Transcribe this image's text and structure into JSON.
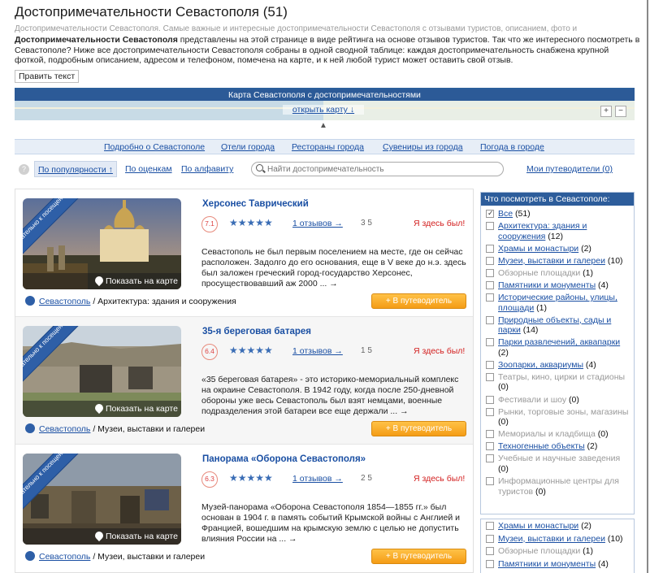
{
  "header": {
    "title": "Достопримечательности Севастополя (51)",
    "subline": "Достопримечательности Севастополя. Самые важные и интересные достопримечательности Севастополя с отзывами туристов, описанием, фото и",
    "intro_bold": "Достопримечательности Севастополя",
    "intro_rest": " представлены на этой странице в виде рейтинга на основе отзывов туристов. Так что же интересного посмотреть в Севастополе? Ниже все достопримечательности Севастополя собраны в одной сводной таблице: каждая достопримечательность снабжена крупной фоткой, подробным описанием, адресом и телефоном, помечена на карте, и к ней любой турист может оставить свой отзыв.",
    "edit_label": "Править текст"
  },
  "map": {
    "title": "Карта Севастополя с достопримечательностями",
    "open_label": "открыть карту ↓",
    "zoom_in": "+",
    "zoom_out": "−",
    "handle": "▲"
  },
  "nav": {
    "links": [
      "Подробно о Севастополе",
      "Отели города",
      "Рестораны города",
      "Сувениры из города",
      "Погода в городе"
    ]
  },
  "sort": {
    "help": "?",
    "popularity": "По популярности ↑",
    "ratings": "По оценкам",
    "alpha": "По алфавиту",
    "search_placeholder": "Найти достопримечательность",
    "my_guides": "Мои путеводители (0)"
  },
  "cards": [
    {
      "title": "Херсонес Таврический",
      "rating": "7.1",
      "stars": "★★★★★",
      "reviews": "1 отзывов →",
      "counts": "3  5",
      "been": "Я здесь был!",
      "badge": "Обязательно к посещению!",
      "show_map": "Показать на карте",
      "desc": "Севастополь не был первым поселением на месте, где он сейчас расположен. Задолго до его основания, еще в V веке до н.э. здесь был заложен греческий город-государство Херсонес, просуществовавший аж 2000 ... →",
      "city": "Севастополь",
      "category": " / Архитектура: здания и сооружения",
      "add": "+ В путеводитель"
    },
    {
      "title": "35-я береговая батарея",
      "rating": "6.4",
      "stars": "★★★★★",
      "reviews": "1 отзывов →",
      "counts": "1  5",
      "been": "Я здесь был!",
      "badge": "Обязательно к посещению!",
      "show_map": "Показать на карте",
      "desc": "«35 береговая батарея» - это историко-мемориальный комплекс на окраине Севастополя. В 1942 году, когда после 250-дневной обороны уже весь Севастополь был взят немцами, военные подразделения этой батареи все еще держали ... →",
      "city": "Севастополь",
      "category": " / Музеи, выставки и галереи",
      "add": "+ В путеводитель"
    },
    {
      "title": "Панорама «Оборона Севастополя»",
      "rating": "6.3",
      "stars": "★★★★★",
      "reviews": "1 отзывов →",
      "counts": "2  5",
      "been": "Я здесь был!",
      "badge": "Обязательно к посещению!",
      "show_map": "Показать на карте",
      "desc": "Музей-панорама «Оборона Севастополя 1854—1855 гг.» был основан в 1904 г. в память событий Крымской войны с Англией и Францией, вошедшим на крымскую землю с целью не допустить влияния России на ... →",
      "city": "Севастополь",
      "category": " / Музеи, выставки и галереи",
      "add": "+ В путеводитель"
    }
  ],
  "sidebar": {
    "title": "Что посмотреть в Севастополе:",
    "items": [
      {
        "label": "Все",
        "count": " (51)",
        "checked": true,
        "enabled": true
      },
      {
        "label": "Архитектура: здания и сооружения",
        "count": " (12)",
        "checked": false,
        "enabled": true
      },
      {
        "label": "Храмы и монастыри",
        "count": " (2)",
        "checked": false,
        "enabled": true
      },
      {
        "label": "Музеи, выставки и галереи",
        "count": " (10)",
        "checked": false,
        "enabled": true
      },
      {
        "label": "Обзорные площадки",
        "count": " (1)",
        "checked": false,
        "enabled": false
      },
      {
        "label": "Памятники и монументы",
        "count": " (4)",
        "checked": false,
        "enabled": true
      },
      {
        "label": "Исторические районы, улицы, площади",
        "count": " (1)",
        "checked": false,
        "enabled": true
      },
      {
        "label": "Природные объекты, сады и парки",
        "count": " (14)",
        "checked": false,
        "enabled": true
      },
      {
        "label": "Парки развлечений, аквапарки",
        "count": " (2)",
        "checked": false,
        "enabled": true
      },
      {
        "label": "Зоопарки, аквариумы",
        "count": " (4)",
        "checked": false,
        "enabled": true
      },
      {
        "label": "Театры, кино, цирки и стадионы",
        "count": " (0)",
        "checked": false,
        "enabled": false
      },
      {
        "label": "Фестивали и шоу",
        "count": " (0)",
        "checked": false,
        "enabled": false
      },
      {
        "label": "Рынки, торговые зоны, магазины",
        "count": " (0)",
        "checked": false,
        "enabled": false
      },
      {
        "label": "Мемориалы и кладбища",
        "count": " (0)",
        "checked": false,
        "enabled": false
      },
      {
        "label": "Техногенные объекты",
        "count": " (2)",
        "checked": false,
        "enabled": true
      },
      {
        "label": "Учебные и научные заведения",
        "count": " (0)",
        "checked": false,
        "enabled": false
      },
      {
        "label": "Информационные центры для туристов",
        "count": " (0)",
        "checked": false,
        "enabled": false
      }
    ],
    "extra": [
      {
        "label": "Храмы и монастыри",
        "count": " (2)",
        "enabled": true
      },
      {
        "label": "Музеи, выставки и галереи",
        "count": " (10)",
        "enabled": true
      },
      {
        "label": "Обзорные площадки",
        "count": " (1)",
        "enabled": false
      },
      {
        "label": "Памятники и монументы",
        "count": " (4)",
        "enabled": true
      }
    ]
  }
}
